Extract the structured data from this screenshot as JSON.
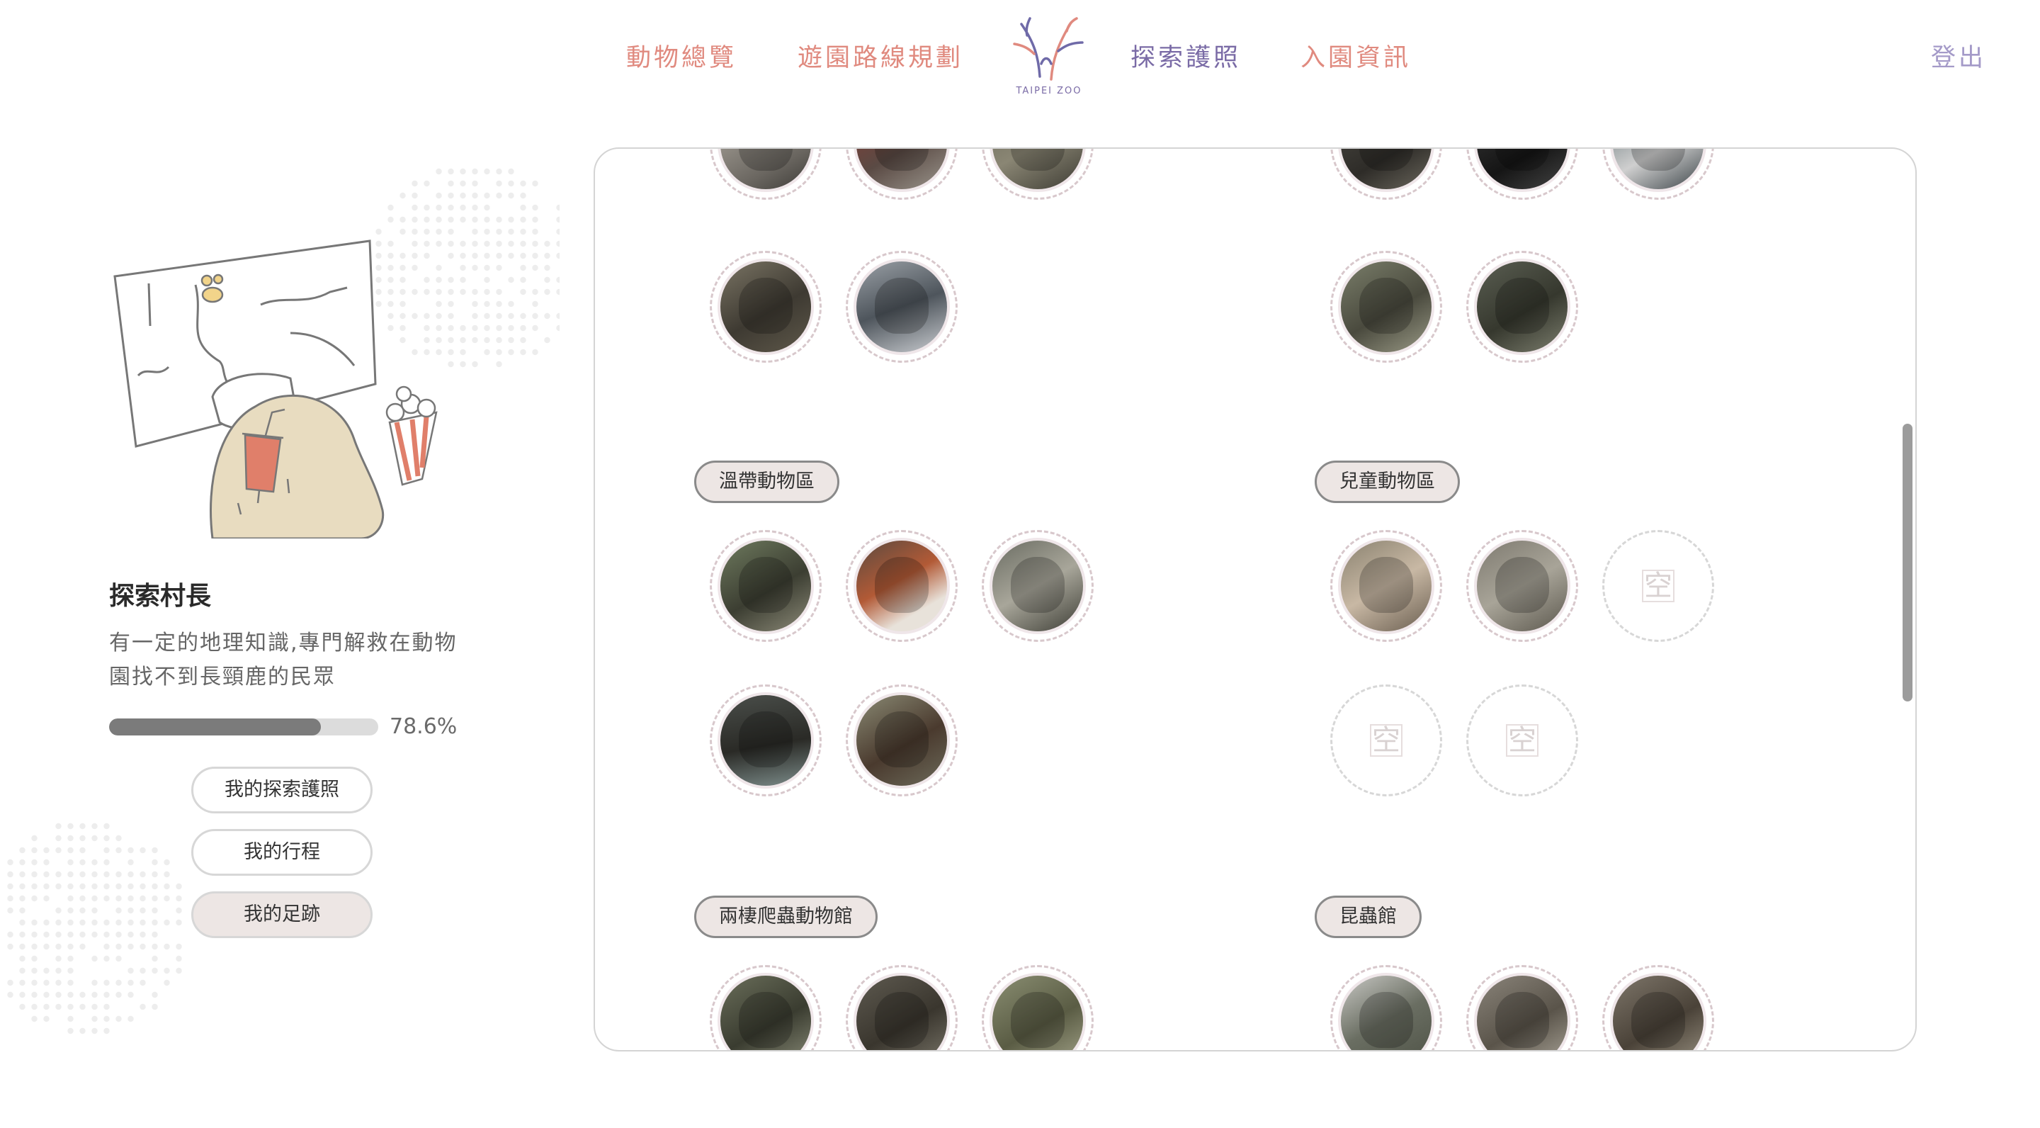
{
  "nav": {
    "animals": "動物總覽",
    "route": "遊園路線規劃",
    "passport": "探索護照",
    "info": "入園資訊",
    "logout": "登出",
    "logo_text": "TAIPEI ZOO"
  },
  "profile": {
    "title": "探索村長",
    "description": "有一定的地理知識,專門解救在動物園找不到長頸鹿的民眾",
    "progress_value": 78.6,
    "progress_label": "78.6%",
    "buttons": {
      "passport": "我的探索護照",
      "trip": "我的行程",
      "footprint": "我的足跡"
    }
  },
  "areas": [
    {
      "name": "溫帶動物區",
      "animals": [
        "otter",
        "red-panda",
        "lynx",
        "beaver",
        "brown-bear"
      ]
    },
    {
      "name": "兒童動物區",
      "animals": [
        "pony",
        "chinchilla",
        "empty",
        "empty",
        "empty"
      ]
    },
    {
      "name": "兩棲爬蟲動物館",
      "animals": [
        "frog",
        "toad",
        "frog"
      ]
    },
    {
      "name": "昆蟲館",
      "animals": [
        "leaf-insect",
        "lizard",
        "scorpion"
      ]
    }
  ],
  "empty_slot_label": "空",
  "colors": {
    "nav_red": "#e08a7f",
    "nav_purple": "#7a6ba6",
    "logout": "#a49ac8",
    "tag_bg": "#ede6e4",
    "progress_fill": "#7b7b7b"
  }
}
